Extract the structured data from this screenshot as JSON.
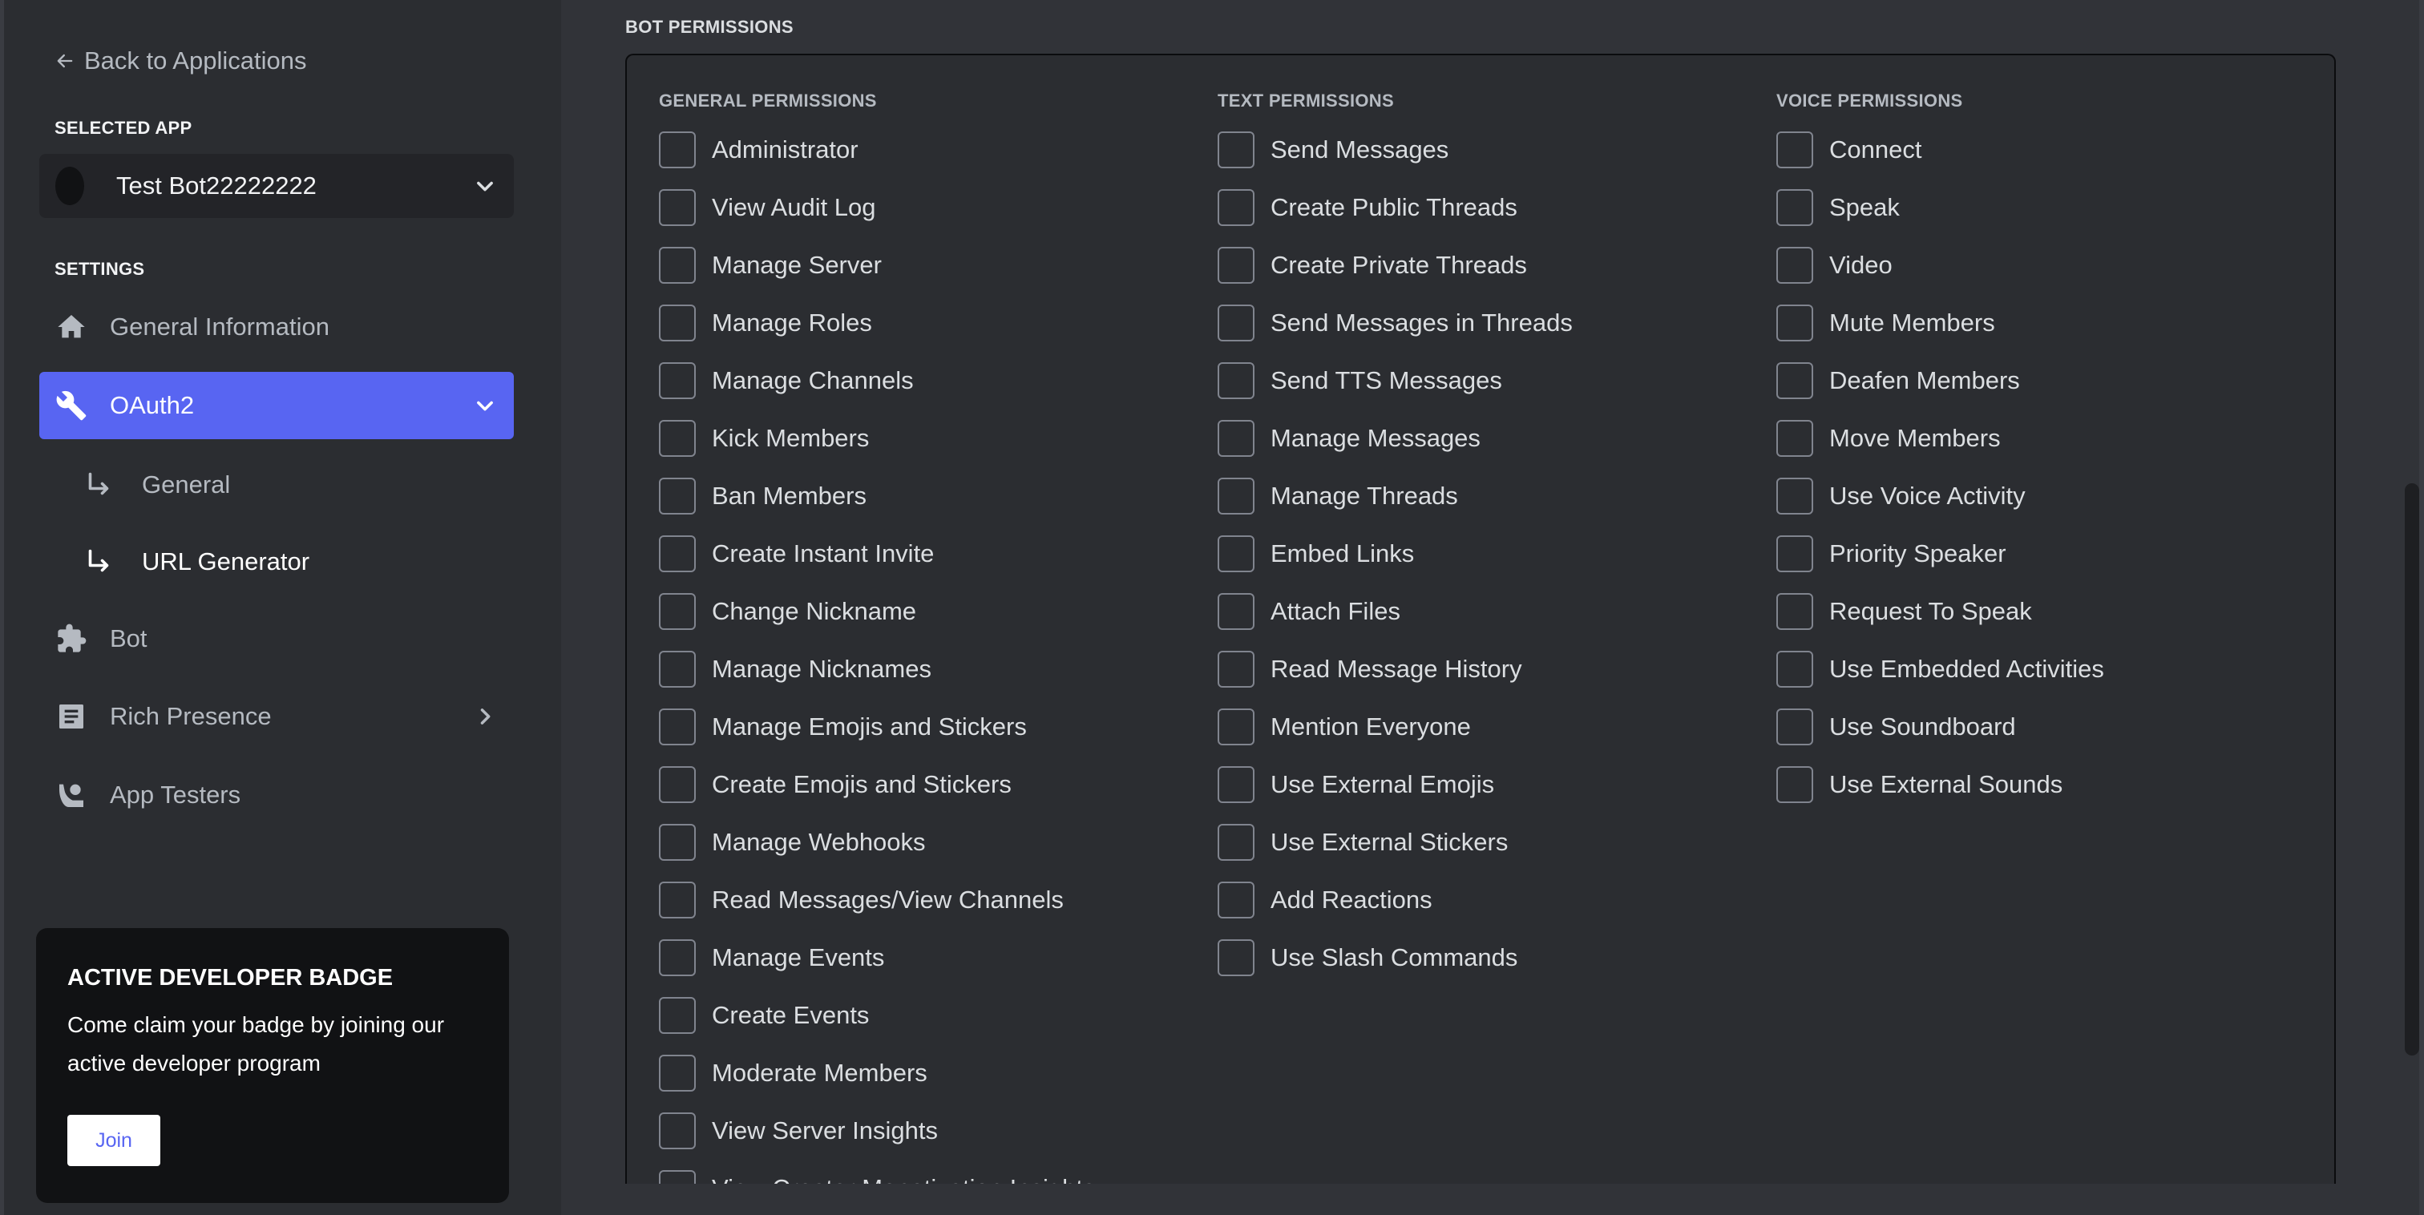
{
  "sidebar": {
    "back_label": "Back to Applications",
    "selected_app_label": "SELECTED APP",
    "selected_app_name": "Test Bot22222222",
    "settings_label": "SETTINGS",
    "items": [
      {
        "label": "General Information",
        "icon": "home-icon"
      },
      {
        "label": "OAuth2",
        "icon": "wrench-icon",
        "active": true,
        "expanded": true
      },
      {
        "label": "Bot",
        "icon": "puzzle-icon"
      },
      {
        "label": "Rich Presence",
        "icon": "document-icon",
        "has_children": true
      },
      {
        "label": "App Testers",
        "icon": "person-phone-icon"
      }
    ],
    "oauth2_subitems": [
      {
        "label": "General",
        "icon": "sub-arrow-icon"
      },
      {
        "label": "URL Generator",
        "icon": "sub-arrow-icon",
        "current": true
      }
    ],
    "badge_card": {
      "title": "ACTIVE DEVELOPER BADGE",
      "text": "Come claim your badge by joining our active developer program",
      "button_label": "Join"
    }
  },
  "colors": {
    "accent": "#5865f2",
    "sidebar_bg": "#2b2d31",
    "main_bg": "#313338",
    "card_bg": "#111214"
  },
  "main": {
    "section_title": "BOT PERMISSIONS",
    "columns": [
      {
        "title": "GENERAL PERMISSIONS",
        "items": [
          {
            "label": "Administrator",
            "checked": false
          },
          {
            "label": "View Audit Log",
            "checked": false
          },
          {
            "label": "Manage Server",
            "checked": false
          },
          {
            "label": "Manage Roles",
            "checked": false
          },
          {
            "label": "Manage Channels",
            "checked": false
          },
          {
            "label": "Kick Members",
            "checked": false
          },
          {
            "label": "Ban Members",
            "checked": false
          },
          {
            "label": "Create Instant Invite",
            "checked": false
          },
          {
            "label": "Change Nickname",
            "checked": false
          },
          {
            "label": "Manage Nicknames",
            "checked": false
          },
          {
            "label": "Manage Emojis and Stickers",
            "checked": false
          },
          {
            "label": "Create Emojis and Stickers",
            "checked": false
          },
          {
            "label": "Manage Webhooks",
            "checked": false
          },
          {
            "label": "Read Messages/View Channels",
            "checked": false
          },
          {
            "label": "Manage Events",
            "checked": false
          },
          {
            "label": "Create Events",
            "checked": false
          },
          {
            "label": "Moderate Members",
            "checked": false
          },
          {
            "label": "View Server Insights",
            "checked": false
          },
          {
            "label": "View Creator Monetization Insights",
            "checked": false
          }
        ]
      },
      {
        "title": "TEXT PERMISSIONS",
        "items": [
          {
            "label": "Send Messages",
            "checked": false
          },
          {
            "label": "Create Public Threads",
            "checked": false
          },
          {
            "label": "Create Private Threads",
            "checked": false
          },
          {
            "label": "Send Messages in Threads",
            "checked": false
          },
          {
            "label": "Send TTS Messages",
            "checked": false
          },
          {
            "label": "Manage Messages",
            "checked": false
          },
          {
            "label": "Manage Threads",
            "checked": false
          },
          {
            "label": "Embed Links",
            "checked": false
          },
          {
            "label": "Attach Files",
            "checked": false
          },
          {
            "label": "Read Message History",
            "checked": false
          },
          {
            "label": "Mention Everyone",
            "checked": false
          },
          {
            "label": "Use External Emojis",
            "checked": false
          },
          {
            "label": "Use External Stickers",
            "checked": false
          },
          {
            "label": "Add Reactions",
            "checked": false
          },
          {
            "label": "Use Slash Commands",
            "checked": false
          }
        ]
      },
      {
        "title": "VOICE PERMISSIONS",
        "items": [
          {
            "label": "Connect",
            "checked": false
          },
          {
            "label": "Speak",
            "checked": false
          },
          {
            "label": "Video",
            "checked": false
          },
          {
            "label": "Mute Members",
            "checked": false
          },
          {
            "label": "Deafen Members",
            "checked": false
          },
          {
            "label": "Move Members",
            "checked": false
          },
          {
            "label": "Use Voice Activity",
            "checked": false
          },
          {
            "label": "Priority Speaker",
            "checked": false
          },
          {
            "label": "Request To Speak",
            "checked": false
          },
          {
            "label": "Use Embedded Activities",
            "checked": false
          },
          {
            "label": "Use Soundboard",
            "checked": false
          },
          {
            "label": "Use External Sounds",
            "checked": false
          }
        ]
      }
    ]
  }
}
